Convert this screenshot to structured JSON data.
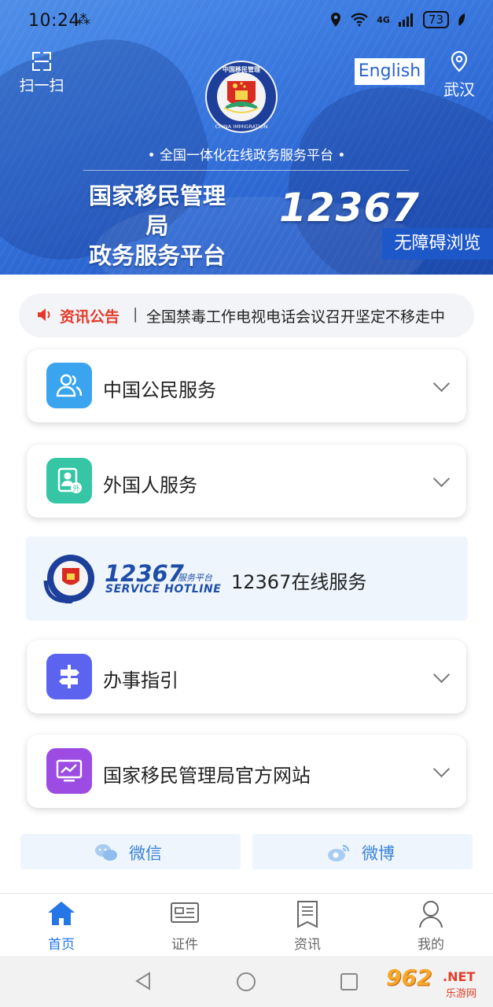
{
  "status_bar": {
    "time": "10:24",
    "network": "4G",
    "battery": "73"
  },
  "header": {
    "scan_label": "扫一扫",
    "english_button": "English",
    "location": "武汉",
    "subtitle": "• 全国一体化在线政务服务平台 •",
    "agency_line1": "国家移民管理局",
    "agency_line2": "政务服务平台",
    "hotline_number": "12367",
    "accessibility_button": "无障碍浏览",
    "emblem_text_cn": "中国移民管理",
    "emblem_text_en": "CHINA IMMIGRATION"
  },
  "notice": {
    "label": "资讯公告",
    "separator": "|",
    "text": "全国禁毒工作电视电话会议召开坚定不移走中"
  },
  "services": [
    {
      "label": "中国公民服务",
      "icon": "citizens-icon",
      "color": "#3aa4ee"
    },
    {
      "label": "外国人服务",
      "icon": "foreigner-icon",
      "color": "#36c6a6"
    },
    {
      "label": "办事指引",
      "icon": "signpost-icon",
      "color": "#5b63ef"
    },
    {
      "label": "国家移民管理局官方网站",
      "icon": "website-icon",
      "color": "#9c4ce3"
    }
  ],
  "hotline_card": {
    "number": "12367",
    "sub": "服务平台",
    "english": "SERVICE HOTLINE",
    "label": "12367在线服务"
  },
  "social": {
    "wechat": "微信",
    "weibo": "微博"
  },
  "tabs": [
    {
      "label": "首页",
      "icon": "home-icon",
      "active": true
    },
    {
      "label": "证件",
      "icon": "id-card-icon",
      "active": false
    },
    {
      "label": "资讯",
      "icon": "news-icon",
      "active": false
    },
    {
      "label": "我的",
      "icon": "profile-icon",
      "active": false
    }
  ],
  "watermark": {
    "number": "962",
    "suffix": ".NET",
    "cn": "乐游网"
  },
  "colors": {
    "primary": "#2a63cf",
    "active_tab": "#2677e6",
    "notice_red": "#e4392a"
  }
}
